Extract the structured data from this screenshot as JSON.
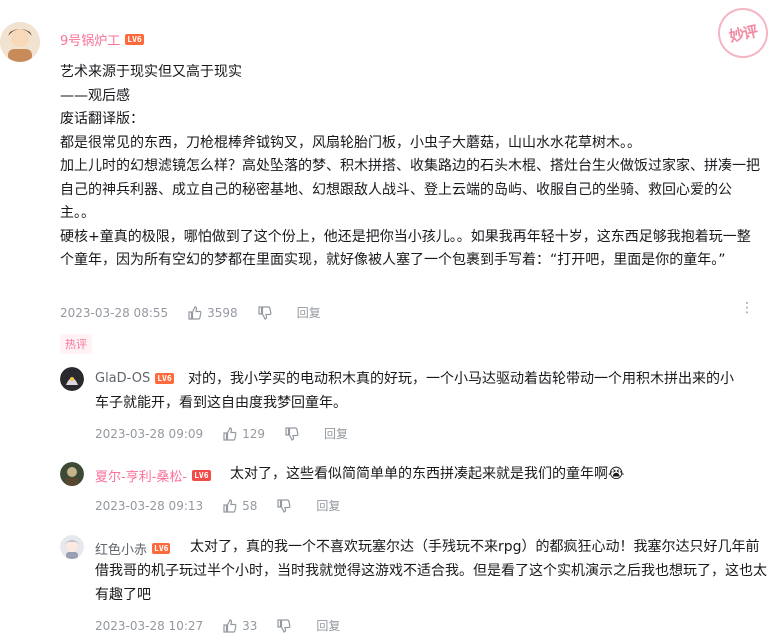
{
  "stamp": "妙评",
  "main": {
    "username": "9号锅炉工",
    "level": "LV6",
    "lines": [
      "艺术来源于现实但又高于现实",
      "——观后感",
      "废话翻译版：",
      "都是很常见的东西，刀枪棍棒斧钺钩叉，风扇轮胎门板，小虫子大蘑菇，山山水水花草树木。。",
      "加上儿时的幻想滤镜怎么样？高处坠落的梦、积木拼搭、收集路边的石头木棍、搭灶台生火做饭过家家、拼凑一把自己的神兵利器、成立自己的秘密基地、幻想跟敌人战斗、登上云端的岛屿、收服自己的坐骑、救回心爱的公主。。",
      "硬核+童真的极限，哪怕做到了这个份上，他还是把你当小孩儿。。如果我再年轻十岁，这东西足够我抱着玩一整个童年，因为所有空幻的梦都在里面实现，就好像被人塞了一个包裹到手写着：“打开吧，里面是你的童年。”"
    ],
    "date": "2023-03-28 08:55",
    "likes": "3598",
    "reply_label": "回复",
    "hot_tag": "热评"
  },
  "replies": [
    {
      "username": "GlaD-OS",
      "level": "LV6",
      "text": "对的，我小学买的电动积木真的好玩，一个小马达驱动着齿轮带动一个用积木拼出来的小车子就能开，看到这自由度我梦回童年。",
      "date": "2023-03-28 09:09",
      "likes": "129",
      "reply_label": "回复"
    },
    {
      "username": "夏尔-亨利-桑松-",
      "level": "LV6",
      "text": "太对了，这些看似简简单单的东西拼凑起来就是我们的童年啊😭",
      "date": "2023-03-28 09:13",
      "likes": "58",
      "reply_label": "回复"
    },
    {
      "username": "红色小赤",
      "level": "LV6",
      "text": "太对了，真的我一个不喜欢玩塞尔达（手残玩不来rpg）的都疯狂心动！我塞尔达只好几年前借我哥的机子玩过半个小时，当时我就觉得这游戏不适合我。但是看了这个实机演示之后我也想玩了，这也太有趣了吧",
      "date": "2023-03-28 10:27",
      "likes": "33",
      "reply_label": "回复"
    }
  ]
}
